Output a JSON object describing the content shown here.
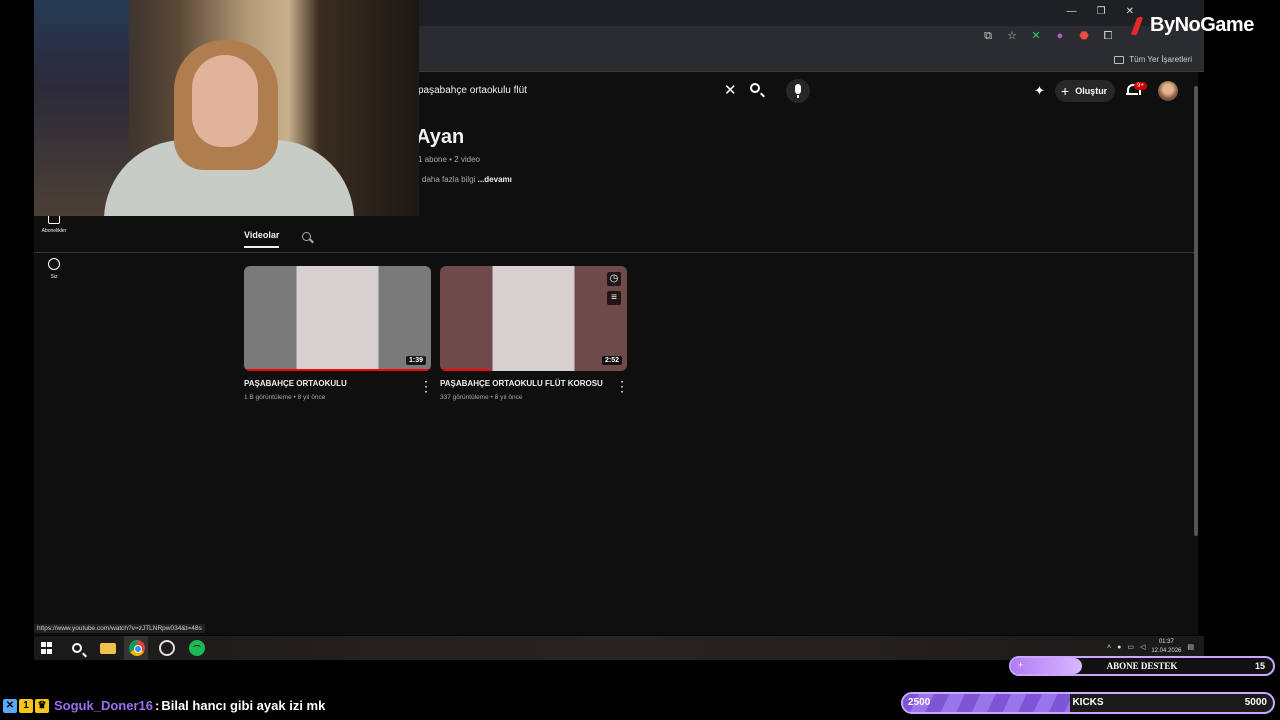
{
  "stream_brand": "ByNoGame",
  "browser": {
    "bookmarks_label": "Tüm Yer İşaretleri",
    "status_url": "https://www.youtube.com/watch?v=zJTLNRpw034&t=48s"
  },
  "youtube": {
    "search_value": "paşabahçe ortaokulu flüt",
    "create_label": "Oluştur",
    "notif_badge": "9+",
    "channel": {
      "name": "Ayan",
      "meta": "1 abone • 2 video",
      "more_prefix": "daha fazla bilgi",
      "more_link": "...devamı"
    },
    "sidebar": [
      {
        "label": "Abonelikler",
        "icon": "subscriptions-icon"
      },
      {
        "label": "Siz",
        "icon": "you-icon"
      }
    ],
    "tabs": {
      "videos": "Videolar"
    },
    "videos": [
      {
        "title": "PAŞABAHÇE ORTAOKULU",
        "meta": "1 B görüntüleme • 8 yıl önce",
        "duration": "1:39",
        "watched_fraction": 1.0,
        "thumb_color": "#7a7a7a"
      },
      {
        "title": "PAŞABAHÇE ORTAOKULU FLÜT KOROSU",
        "meta": "337 görüntüleme • 8 yıl önce",
        "duration": "2:52",
        "watched_fraction": 0.27,
        "thumb_color": "#6e4a4a"
      }
    ]
  },
  "taskbar": {
    "time": "01:37",
    "date": "12.04.2026"
  },
  "overlays": {
    "sub_goal": {
      "label": "ABONE DESTEK",
      "count": "15",
      "plus": "+",
      "fill_fraction": 0.27
    },
    "kicks": {
      "label": "KICKS",
      "min": "2500",
      "max": "5000",
      "fill_fraction": 0.45
    },
    "chat": {
      "user": "Soguk_Doner16",
      "separator": ":",
      "message": "Bilal hancı gibi ayak izi mk"
    }
  }
}
